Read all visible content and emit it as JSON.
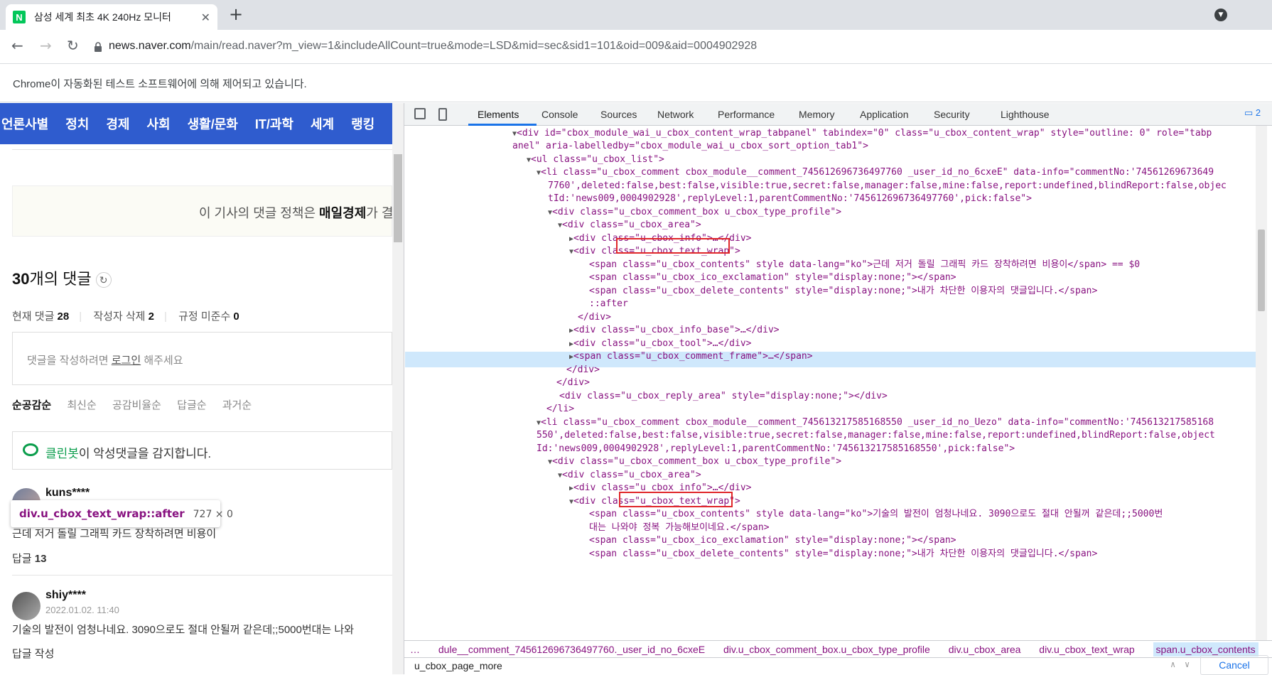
{
  "browser": {
    "tab_title": "삼성 세계 최초 4K 240Hz 모니터",
    "favicon_letter": "N",
    "url_host": "news.naver.com",
    "url_path": "/main/read.naver?m_view=1&includeAllCount=true&mode=LSD&mid=sec&sid1=101&oid=009&aid=0004902928",
    "automation_notice": "Chrome이 자동화된 테스트 소프트웨어에 의해 제어되고 있습니다."
  },
  "page": {
    "nav_items": [
      "언론사별",
      "정치",
      "경제",
      "사회",
      "생활/문화",
      "IT/과학",
      "세계",
      "랭킹"
    ],
    "policy_prefix": "이 기사의 댓글 정책은 ",
    "policy_press": "매일경제",
    "policy_suffix": "가 결",
    "count_num": "30",
    "count_label": "개의 댓글",
    "stats": [
      {
        "label": "현재 댓글",
        "value": "28"
      },
      {
        "label": "작성자 삭제",
        "value": "2"
      },
      {
        "label": "규정 미준수",
        "value": "0"
      }
    ],
    "write_prefix": "댓글을 작성하려면 ",
    "write_login": "로그인",
    "write_suffix": " 해주세요",
    "sort_options": [
      "순공감순",
      "최신순",
      "공감비율순",
      "답글순",
      "과거순"
    ],
    "cleanbot_name": "클린봇",
    "cleanbot_text": "이 악성댓글을 감지합니다.",
    "comments": [
      {
        "user": "kuns****",
        "text": "근데 저거 돌릴 그래픽 카드 장착하려면 비용이",
        "reply_label": "답글",
        "reply_count": "13"
      },
      {
        "user": "shiy****",
        "date": "2022.01.02. 11:40",
        "text": "기술의 발전이 엄청나네요. 3090으로도 절대 안될꺼 같은데;;5000번대는 나와",
        "reply_label": "답글 작성"
      }
    ],
    "tooltip_selector": "div.u_cbox_text_wrap::after",
    "tooltip_size": "727 × 0"
  },
  "devtools": {
    "tabs": [
      "Elements",
      "Console",
      "Sources",
      "Network",
      "Performance",
      "Memory",
      "Application",
      "Security",
      "Lighthouse"
    ],
    "issues_count": "2",
    "lines": [
      "<div id=\"cbox_module_wai_u_cbox_content_wrap_tabpanel\" tabindex=\"0\" class=\"u_cbox_content_wrap\" style=\"outline: 0\" role=\"tabp",
      "anel\" aria-labelledby=\"cbox_module_wai_u_cbox_sort_option_tab1\">",
      "<ul class=\"u_cbox_list\">",
      "<li class=\"u_cbox_comment cbox_module__comment_745612696736497760 _user_id_no_6cxeE\" data-info=\"commentNo:'74561269673649",
      "7760',deleted:false,best:false,visible:true,secret:false,manager:false,mine:false,report:undefined,blindReport:false,objec",
      "tId:'news009,0004902928',replyLevel:1,parentCommentNo:'745612696736497760',pick:false\">",
      "<div class=\"u_cbox_comment_box u_cbox_type_profile\">",
      "<div class=\"u_cbox_area\">",
      "<div class=\"u_cbox_info\">…</div>",
      "<div class=\"u_cbox_text_wrap\">",
      "<span class=\"u_cbox_contents\" style data-lang=\"ko\">근데 저거 돌릴 그래픽 카드 장착하려면 비용이</span> == $0",
      "<span class=\"u_cbox_ico_exclamation\" style=\"display:none;\"></span>",
      "<span class=\"u_cbox_delete_contents\" style=\"display:none;\">내가 차단한 이용자의 댓글입니다.</span>",
      "::after",
      "</div>",
      "<div class=\"u_cbox_info_base\">…</div>",
      "<div class=\"u_cbox_tool\">…</div>",
      "<span class=\"u_cbox_comment_frame\">…</span>",
      "</div>",
      "</div>",
      "<div class=\"u_cbox_reply_area\" style=\"display:none;\"></div>",
      "</li>",
      "<li class=\"u_cbox_comment cbox_module__comment_745613217585168550 _user_id_no_Uezo\" data-info=\"commentNo:'745613217585168",
      "550',deleted:false,best:false,visible:true,secret:false,manager:false,mine:false,report:undefined,blindReport:false,object",
      "Id:'news009,0004902928',replyLevel:1,parentCommentNo:'745613217585168550',pick:false\">",
      "<div class=\"u_cbox_comment_box u_cbox_type_profile\">",
      "<div class=\"u_cbox_area\">",
      "<div class=\"u_cbox_info\">…</div>",
      "<div class=\"u_cbox_text_wrap\">",
      "<span class=\"u_cbox_contents\" style data-lang=\"ko\">기술의 발전이 엄청나네요. 3090으로도 절대 안될꺼 같은데;;5000번",
      "대는 나와야 정복 가능해보이네요.</span>",
      "<span class=\"u_cbox_ico_exclamation\" style=\"display:none;\"></span>",
      "<span class=\"u_cbox_delete_contents\" style=\"display:none;\">내가 차단한 이용자의 댓글입니다.</span>"
    ],
    "breadcrumbs": [
      "…",
      "dule__comment_745612696736497760._user_id_no_6cxeE",
      "div.u_cbox_comment_box.u_cbox_type_profile",
      "div.u_cbox_area",
      "div.u_cbox_text_wrap",
      "span.u_cbox_contents",
      "…"
    ],
    "search_value": "u_cbox_page_more",
    "cancel_label": "Cancel"
  }
}
